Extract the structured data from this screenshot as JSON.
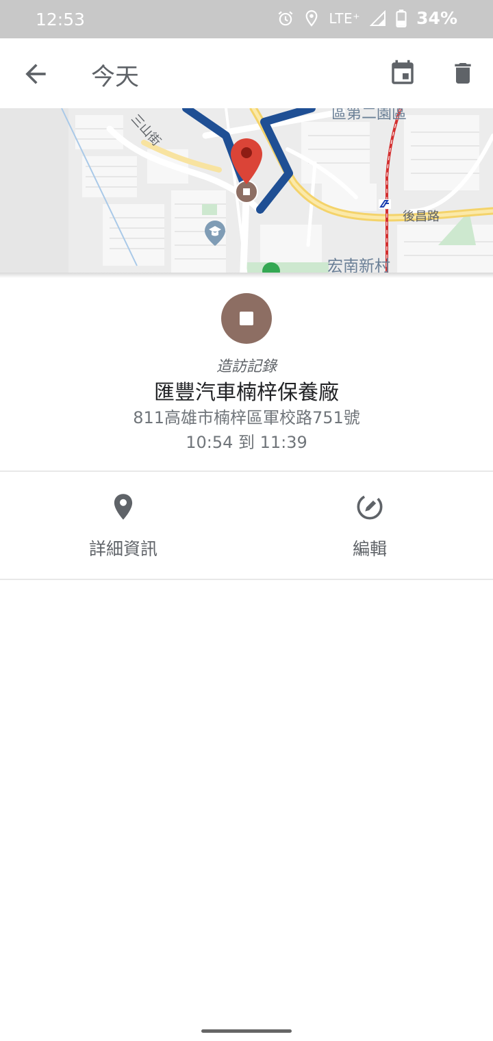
{
  "status_bar": {
    "time": "12:53",
    "network": "LTE⁺",
    "battery": "34%",
    "icons": [
      "alarm-icon",
      "location-icon",
      "signal-icon",
      "battery-icon"
    ]
  },
  "app_bar": {
    "title": "今天",
    "icons": [
      "back-arrow-icon",
      "calendar-icon",
      "trash-icon"
    ]
  },
  "map": {
    "labels": {
      "street": "三山街",
      "district": "區第二園區",
      "road": "後昌路",
      "village": "宏南新村"
    },
    "colors": {
      "route": "#1f4f94",
      "pin": "#db4437",
      "rail": "#d32f2f",
      "major_road": "#f4d36a"
    }
  },
  "visit": {
    "type_label": "造訪記錄",
    "place_name": "匯豐汽車楠梓保養廠",
    "address": "811高雄市楠梓區軍校路751號",
    "time_range": "10:54 到 11:39",
    "icon_color": "#8d6e63"
  },
  "actions": [
    {
      "label": "詳細資訊",
      "icon": "place-icon"
    },
    {
      "label": "編輯",
      "icon": "edit-icon"
    }
  ]
}
